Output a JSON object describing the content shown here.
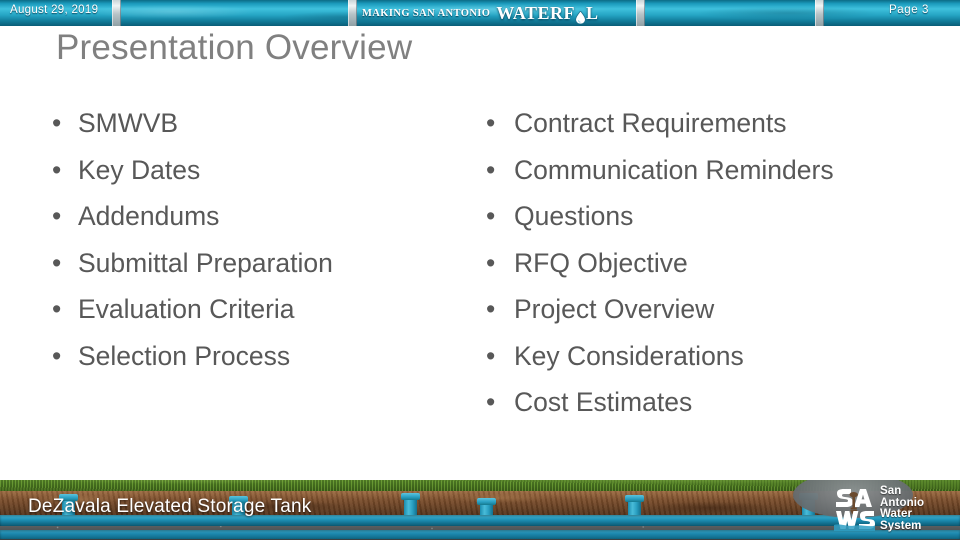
{
  "header": {
    "date": "August 29, 2019",
    "page_label": "Page 3",
    "brand_prefix": "MAKING SAN ANTONIO",
    "brand_name": "WATERFUL",
    "brand_drop_icon": "water-drop-icon"
  },
  "title": "Presentation Overview",
  "content": {
    "left_column": [
      "SMWVB",
      "Key Dates",
      "Addendums",
      "Submittal Preparation",
      "Evaluation Criteria",
      "Selection Process"
    ],
    "right_column": [
      "Contract Requirements",
      "Communication Reminders",
      "Questions",
      "RFQ Objective",
      "Project Overview",
      "Key Considerations",
      "Cost Estimates"
    ],
    "bullet_glyph": "•"
  },
  "footer": {
    "caption": "DeZavala Elevated Storage Tank",
    "graphic_name": "underground-water-pipes-illustration"
  },
  "logo": {
    "mark_name": "saws-monogram-icon",
    "line1": "San",
    "line2": "Antonio",
    "line3": "Water",
    "line4": "System"
  },
  "colors": {
    "header_pipe_blue": "#1f9bbd",
    "title_gray": "#808080",
    "body_gray": "#585858",
    "grass_green": "#4d7a22",
    "soil_brown": "#7d4f2c",
    "pipe_blue": "#1f93b8",
    "logo_oval_gray": "#6d7376",
    "white": "#ffffff"
  }
}
